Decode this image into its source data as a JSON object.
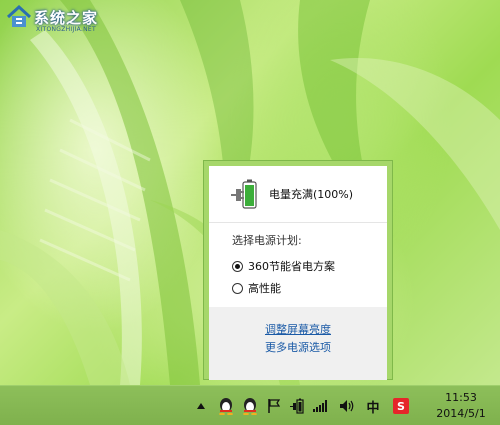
{
  "logo": {
    "text": "系统之家",
    "subtext": "XITONGZHIJIA.NET"
  },
  "power_flyout": {
    "status": "电量充满(100%)",
    "plan_label": "选择电源计划:",
    "plans": [
      {
        "label": "360节能省电方案",
        "selected": true
      },
      {
        "label": "高性能",
        "selected": false
      }
    ],
    "links": {
      "brightness": "调整屏幕亮度",
      "more_options": "更多电源选项"
    }
  },
  "taskbar": {
    "ime_label": "中",
    "sogou_label": "S",
    "clock": {
      "time": "11:53",
      "date": "2014/5/1"
    }
  },
  "colors": {
    "flyout_border": "#a6d76a",
    "link": "#1a5aa6",
    "taskbar": "#86b854"
  }
}
